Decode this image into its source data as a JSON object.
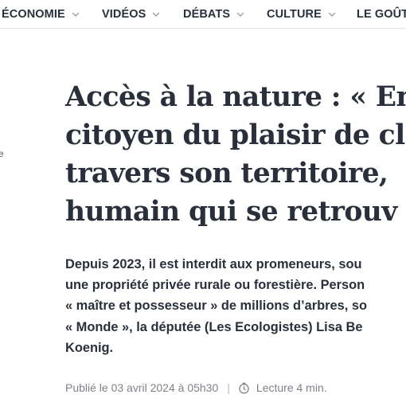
{
  "nav": {
    "items": [
      {
        "label": "ÉCONOMIE",
        "has_dropdown": true
      },
      {
        "label": "VIDÉOS",
        "has_dropdown": true
      },
      {
        "label": "DÉBATS",
        "has_dropdown": true
      },
      {
        "label": "CULTURE",
        "has_dropdown": true
      },
      {
        "label": "LE GOÛT",
        "has_dropdown": false
      }
    ],
    "chevron_icon": "chevron-down-icon"
  },
  "side_fragment": "e",
  "article": {
    "title_lines": [
      "Accès à la nature : « En",
      "citoyen du plaisir de cl",
      "travers son territoire, ",
      "humain qui se retrouv"
    ],
    "chapo_lines": [
      "Depuis 2023, il est interdit aux promeneurs, sou",
      "une propriété privée rurale ou forestière. Person",
      "« maître et possesseur » de millions d’arbres, so",
      "« Monde », la députée (Les Ecologistes) Lisa Be",
      "Koenig."
    ],
    "meta": {
      "published": "Publié le 03 avril 2024 à 05h30",
      "separator": "|",
      "reading_icon": "clock-icon",
      "reading_time": "Lecture 4 min."
    }
  },
  "colors": {
    "text": "#2a303b",
    "meta": "#7d828a",
    "divider": "#e6e6e6"
  }
}
